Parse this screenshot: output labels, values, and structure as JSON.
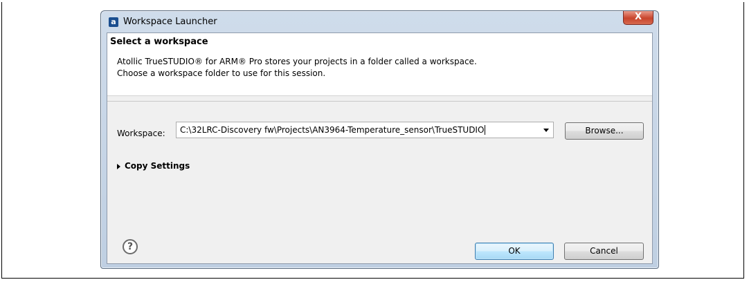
{
  "window": {
    "title": "Workspace Launcher",
    "app_icon_glyph": "a",
    "close_glyph": "X"
  },
  "banner": {
    "title": "Select a workspace",
    "desc_line1": "Atollic TrueSTUDIO® for ARM® Pro stores your projects in a folder called a workspace.",
    "desc_line2": "Choose a workspace folder to use for this session."
  },
  "workspace": {
    "label": "Workspace:",
    "value": "C:\\32LRC-Discovery fw\\Projects\\AN3964-Temperature_sensor\\TrueSTUDIO",
    "browse_label": "Browse..."
  },
  "copy_settings": {
    "label": "Copy Settings",
    "expanded": false
  },
  "footer": {
    "help_glyph": "?",
    "ok_label": "OK",
    "cancel_label": "Cancel"
  },
  "colors": {
    "window_frame": "#bfcfe2",
    "close_button": "#c8442c",
    "default_button_border": "#3c7fb1"
  },
  "icons": {
    "app": "atollic-app-icon",
    "close": "close-icon",
    "dropdown": "chevron-down-icon",
    "expand": "triangle-right-icon",
    "help": "help-icon"
  }
}
